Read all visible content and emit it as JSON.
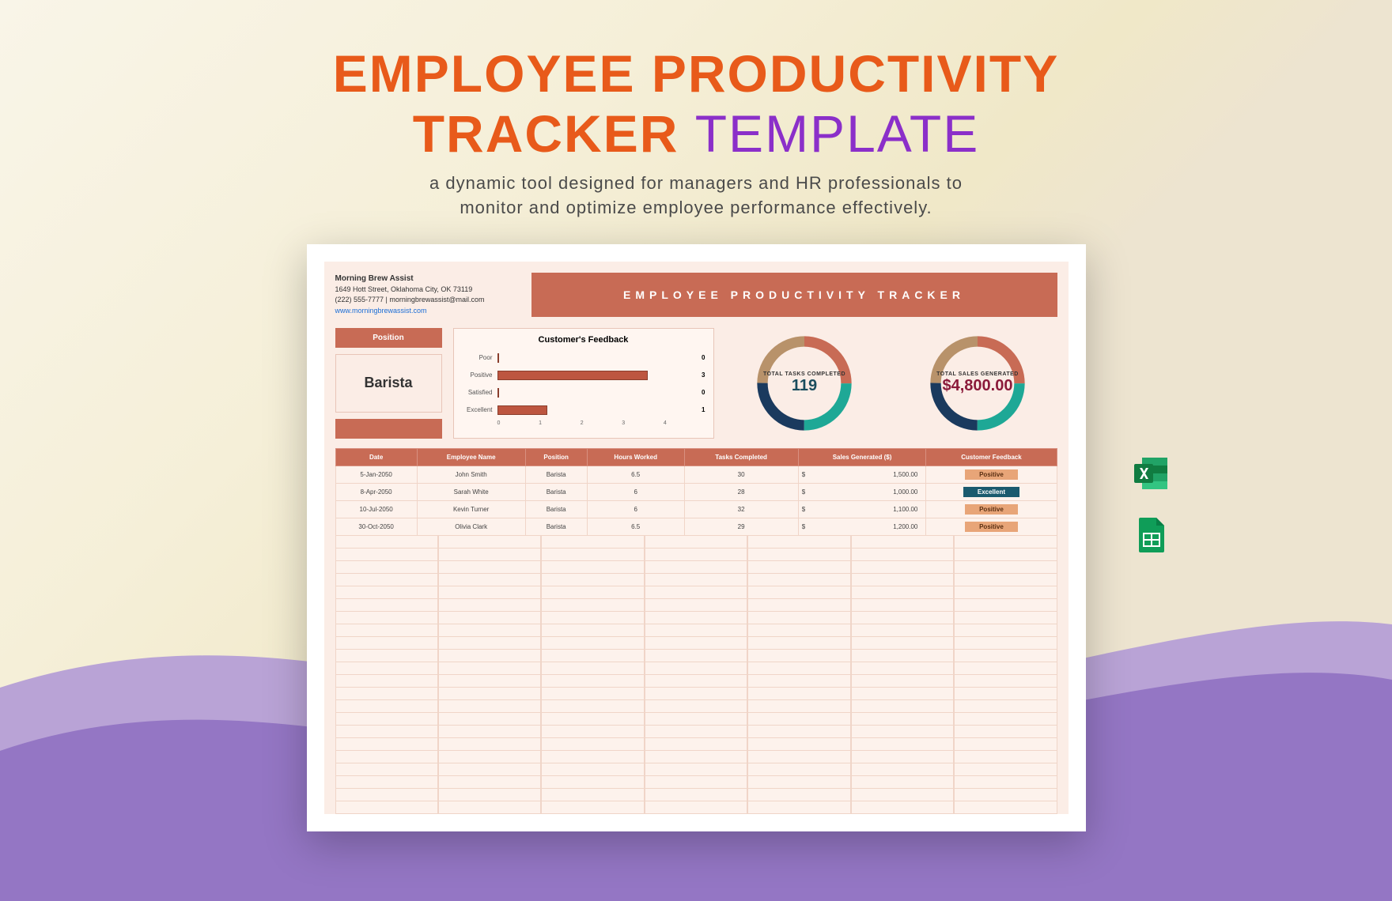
{
  "title": {
    "line1": "EMPLOYEE PRODUCTIVITY",
    "line2a": "TRACKER",
    "line2b": "TEMPLATE"
  },
  "subtitle": "a dynamic tool designed for managers and HR professionals to\nmonitor and optimize employee performance effectively.",
  "company": {
    "name": "Morning Brew Assist",
    "address": "1649 Hott Street, Oklahoma City, OK 73119",
    "contact": "(222) 555-7777 | morningbrewassist@mail.com",
    "website": "www.morningbrewassist.com"
  },
  "banner": "EMPLOYEE PRODUCTIVITY TRACKER",
  "position": {
    "label": "Position",
    "value": "Barista"
  },
  "chart_data": {
    "type": "bar",
    "title": "Customer's Feedback",
    "categories": [
      "Poor",
      "Positive",
      "Satisfied",
      "Excellent"
    ],
    "values": [
      0,
      3,
      0,
      1
    ],
    "xlabel": "",
    "ylabel": "",
    "xlim": [
      0,
      4
    ],
    "ticks": [
      "0",
      "1",
      "2",
      "3",
      "4"
    ]
  },
  "kpi": {
    "tasks": {
      "label": "TOTAL TASKS COMPLETED",
      "value": "119"
    },
    "sales": {
      "label": "TOTAL SALES GENERATED",
      "value": "$4,800.00"
    }
  },
  "table": {
    "headers": [
      "Date",
      "Employee Name",
      "Position",
      "Hours Worked",
      "Tasks Completed",
      "Sales Generated ($)",
      "Customer Feedback"
    ],
    "rows": [
      {
        "date": "5-Jan-2050",
        "name": "John Smith",
        "position": "Barista",
        "hours": "6.5",
        "tasks": "30",
        "sales": "1,500.00",
        "feedback": "Positive",
        "badge": "positive"
      },
      {
        "date": "8-Apr-2050",
        "name": "Sarah White",
        "position": "Barista",
        "hours": "6",
        "tasks": "28",
        "sales": "1,000.00",
        "feedback": "Excellent",
        "badge": "excellent"
      },
      {
        "date": "10-Jul-2050",
        "name": "Kevin Turner",
        "position": "Barista",
        "hours": "6",
        "tasks": "32",
        "sales": "1,100.00",
        "feedback": "Positive",
        "badge": "positive"
      },
      {
        "date": "30-Oct-2050",
        "name": "Olivia Clark",
        "position": "Barista",
        "hours": "6.5",
        "tasks": "29",
        "sales": "1,200.00",
        "feedback": "Positive",
        "badge": "positive"
      }
    ]
  },
  "icons": {
    "excel": "Excel",
    "sheets": "Google Sheets"
  }
}
